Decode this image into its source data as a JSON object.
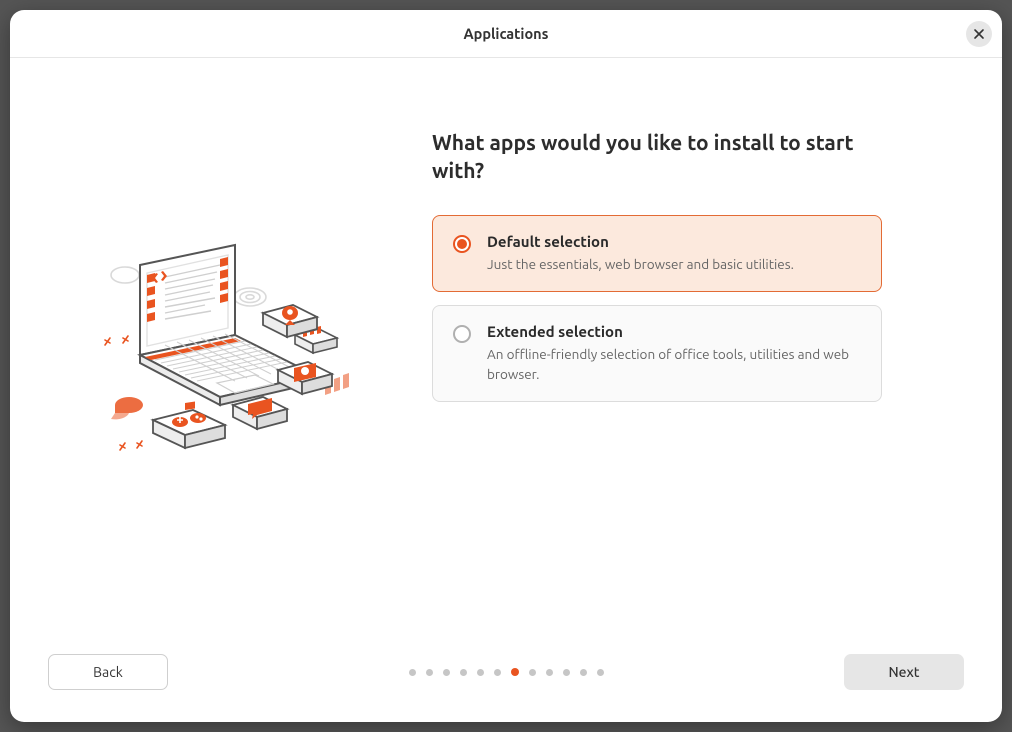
{
  "titlebar": {
    "title": "Applications"
  },
  "heading": "What apps would you like to install to start with?",
  "options": [
    {
      "title": "Default selection",
      "desc": "Just the essentials, web browser and basic utilities.",
      "selected": true
    },
    {
      "title": "Extended selection",
      "desc": "An offline-friendly selection of office tools, utilities and web browser.",
      "selected": false
    }
  ],
  "footer": {
    "back_label": "Back",
    "next_label": "Next"
  },
  "pager": {
    "total": 12,
    "current_index": 6
  },
  "colors": {
    "accent": "#e95420",
    "selected_bg": "#fce9dd",
    "selected_border": "#e36b35"
  }
}
